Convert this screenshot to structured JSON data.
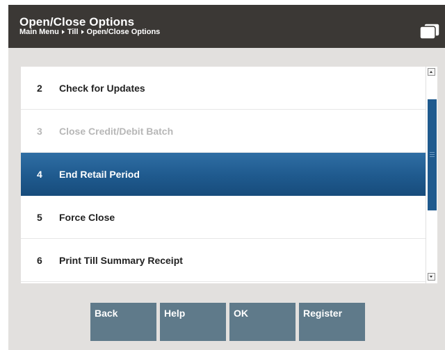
{
  "header": {
    "title": "Open/Close Options",
    "breadcrumb": [
      "Main Menu",
      "Till",
      "Open/Close Options"
    ],
    "icon": "windows-icon"
  },
  "options": [
    {
      "number": "2",
      "label": "Check for Updates",
      "state": "normal"
    },
    {
      "number": "3",
      "label": "Close Credit/Debit Batch",
      "state": "disabled"
    },
    {
      "number": "4",
      "label": "End Retail Period",
      "state": "selected"
    },
    {
      "number": "5",
      "label": "Force Close",
      "state": "normal"
    },
    {
      "number": "6",
      "label": "Print Till Summary Receipt",
      "state": "normal"
    }
  ],
  "buttons": {
    "back": "Back",
    "help": "Help",
    "ok": "OK",
    "register": "Register"
  },
  "colors": {
    "header_bg": "#3b3835",
    "content_bg": "#e2e0de",
    "selected_bg": "#1f5a8e",
    "disabled_text": "#b7b7b7",
    "button_bg": "#5f7a8a"
  }
}
